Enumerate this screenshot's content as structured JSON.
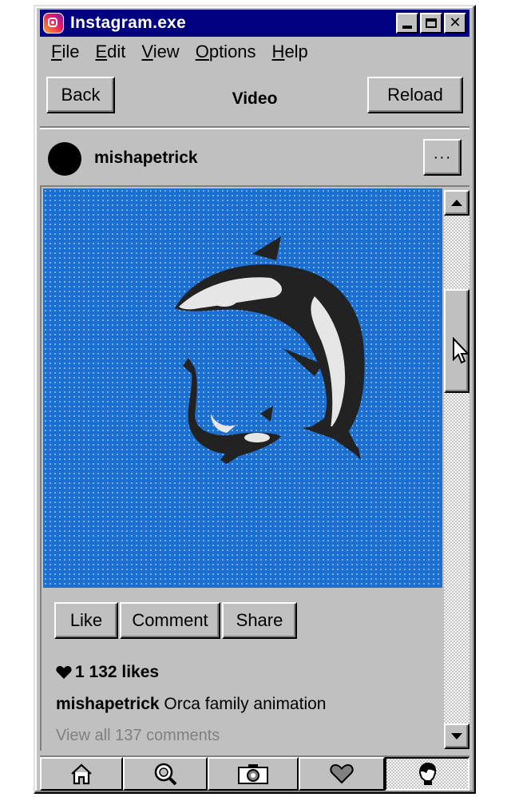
{
  "window": {
    "title": "Instagram.exe",
    "app_icon": "instagram-icon"
  },
  "menu": {
    "items": [
      {
        "key": "F",
        "rest": "ile"
      },
      {
        "key": "E",
        "rest": "dit"
      },
      {
        "key": "V",
        "rest": "iew"
      },
      {
        "key": "O",
        "rest": "ptions"
      },
      {
        "key": "H",
        "rest": "elp"
      }
    ]
  },
  "nav": {
    "back_label": "Back",
    "title": "Video",
    "reload_label": "Reload"
  },
  "post": {
    "username": "mishapetrick",
    "more_label": "···",
    "like_label": "Like",
    "comment_label": "Comment",
    "share_label": "Share",
    "likes_text": "1 132 likes",
    "caption_user": "mishapetrick",
    "caption_text": "Orca family animation",
    "comments_link": "View all 137 comments"
  },
  "colors": {
    "titlebar": "#000080",
    "media_bg": "#1a6fd0",
    "chrome": "#c0c0c0"
  },
  "tabs": [
    {
      "icon": "home-icon",
      "active": false
    },
    {
      "icon": "search-icon",
      "active": false
    },
    {
      "icon": "camera-icon",
      "active": false
    },
    {
      "icon": "heart-icon",
      "active": false
    },
    {
      "icon": "profile-icon",
      "active": true
    }
  ]
}
